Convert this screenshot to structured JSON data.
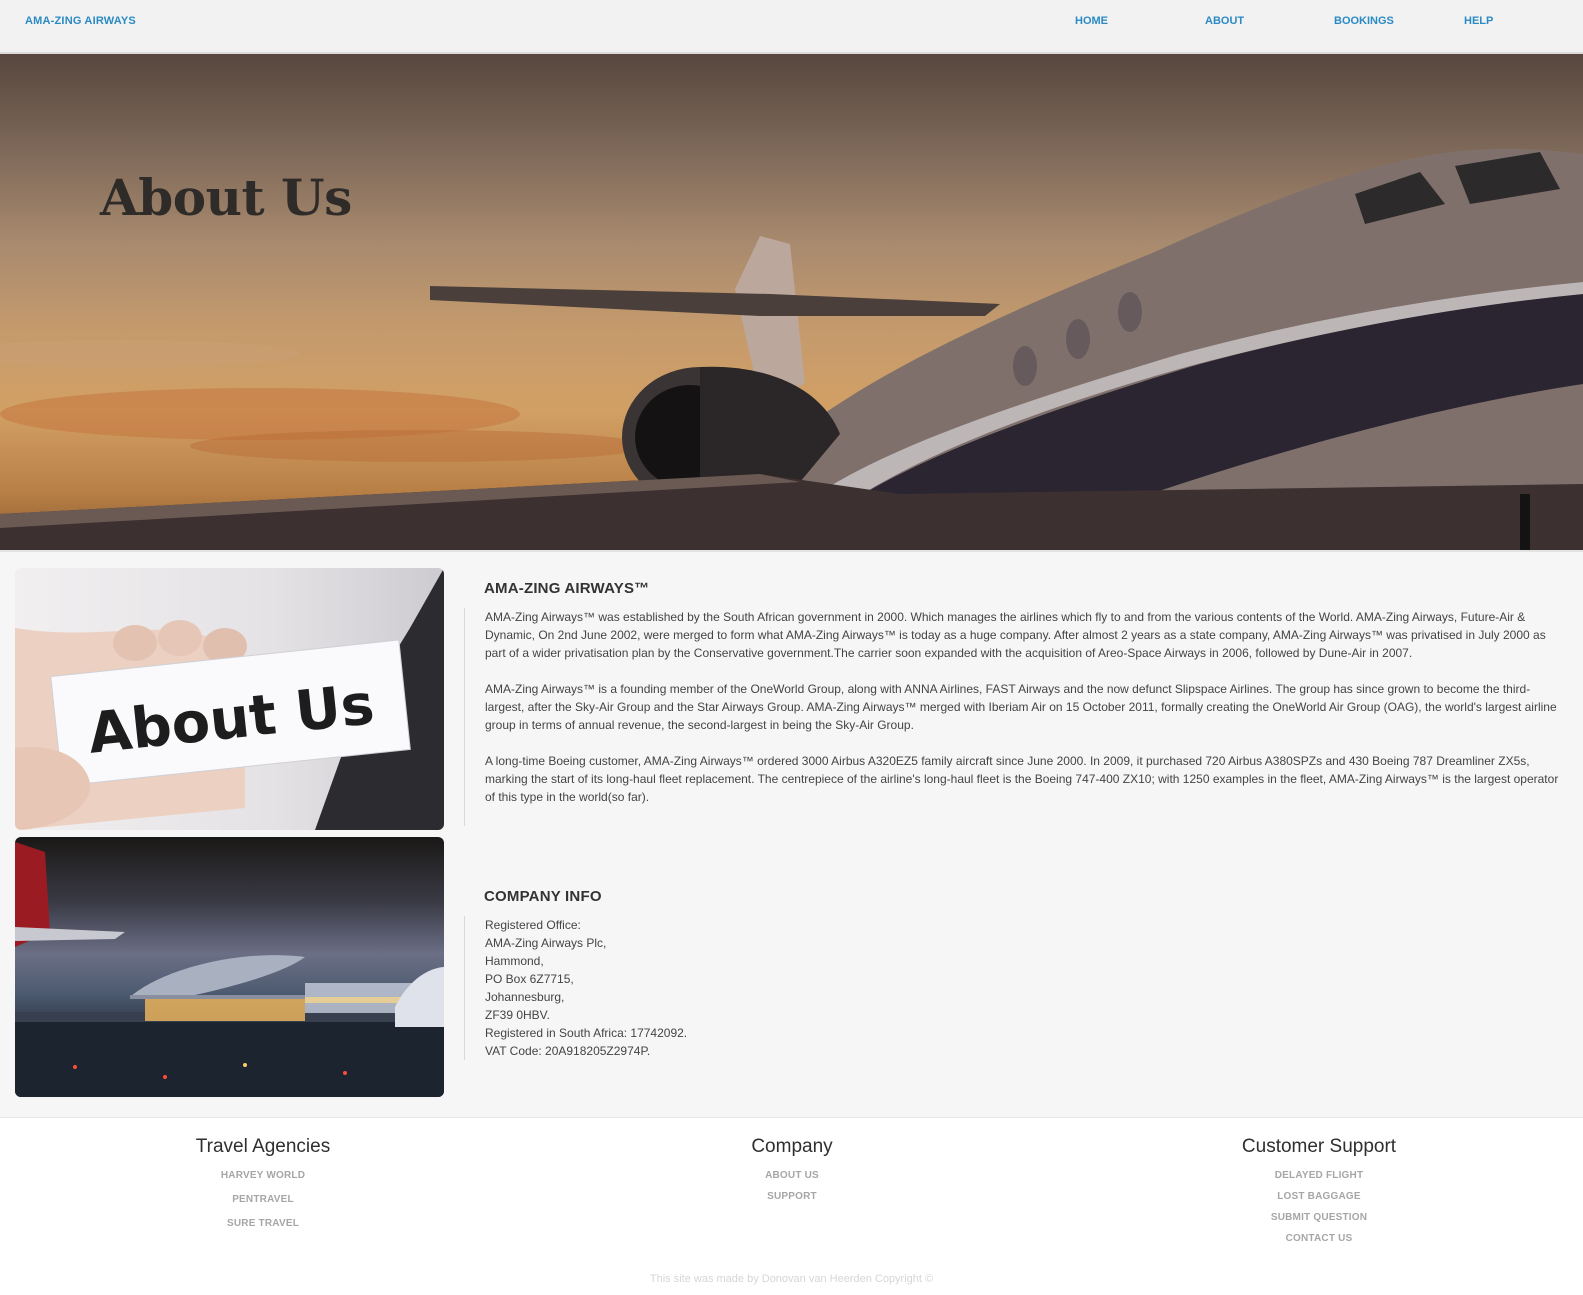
{
  "navbar": {
    "brand": "AMA-ZING AIRWAYS",
    "items": [
      {
        "label": "HOME"
      },
      {
        "label": "ABOUT"
      },
      {
        "label": "BOOKINGS"
      },
      {
        "label": "HELP"
      }
    ]
  },
  "hero": {
    "title": "About Us"
  },
  "side_images": {
    "card_text": "About Us"
  },
  "about": {
    "heading": "AMA-ZING AIRWAYS™",
    "paragraphs": [
      "AMA-Zing Airways™ was established by the South African government in 2000. Which manages the airlines which fly to and from the various contents of the World. AMA-Zing Airways, Future-Air & Dynamic, On 2nd June 2002, were merged to form what AMA-Zing Airways™ is today as a huge company. After almost 2 years as a state company, AMA-Zing Airways™ was privatised in July 2000 as part of a wider privatisation plan by the Conservative government.The carrier soon expanded with the acquisition of Areo-Space Airways in 2006, followed by Dune-Air in 2007.",
      "AMA-Zing Airways™ is a founding member of the OneWorld Group, along with ANNA Airlines, FAST Airways and the now defunct Slipspace Airlines. The group has since grown to become the third-largest, after the Sky-Air Group and the Star Airways Group. AMA-Zing Airways™ merged with Iberiam Air on 15 October 2011, formally creating the OneWorld Air Group (OAG), the world's largest airline group in terms of annual revenue, the second-largest in being the Sky-Air Group.",
      "A long-time Boeing customer, AMA-Zing Airways™ ordered 3000 Airbus A320EZ5 family aircraft since June 2000. In 2009, it purchased 720 Airbus A380SPZs and 430 Boeing 787 Dreamliner ZX5s, marking the start of its long-haul fleet replacement. The centrepiece of the airline's long-haul fleet is the Boeing 747-400 ZX10; with 1250 examples in the fleet, AMA-Zing Airways™ is the largest operator of this type in the world(so far)."
    ]
  },
  "company_info": {
    "heading": "COMPANY INFO",
    "lines": [
      "Registered Office:",
      "AMA-Zing Airways Plc,",
      "Hammond,",
      "PO Box 6Z7715,",
      "Johannesburg,",
      "ZF39 0HBV.",
      "Registered in South Africa: 17742092.",
      "VAT Code: 20A918205Z2974P."
    ]
  },
  "footer": {
    "columns": [
      {
        "heading": "Travel Agencies",
        "links": [
          "HARVEY WORLD",
          "PENTRAVEL",
          "SURE TRAVEL"
        ]
      },
      {
        "heading": "Company",
        "links": [
          "ABOUT US",
          "SUPPORT"
        ]
      },
      {
        "heading": "Customer Support",
        "links": [
          "DELAYED FLIGHT",
          "LOST BAGGAGE",
          "SUBMIT QUESTION",
          "CONTACT US"
        ]
      }
    ],
    "copyright": "This site was made by Donovan van Heerden Copyright ©"
  }
}
